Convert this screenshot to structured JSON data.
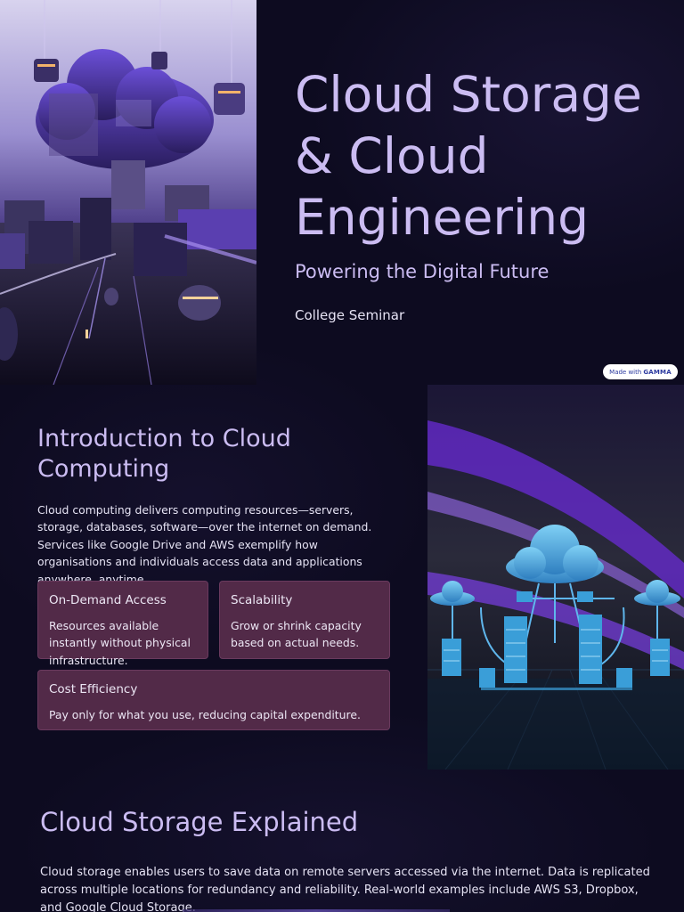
{
  "hero": {
    "title": "Cloud Storage & Cloud Engineering",
    "subtitle": "Powering the Digital Future",
    "tagline": "College Seminar",
    "badge_prefix": "Made with",
    "badge_brand": "GAMMA"
  },
  "intro": {
    "title": "Introduction to Cloud Computing",
    "body": "Cloud computing delivers computing resources—servers, storage, databases, software—over the internet on demand. Services like Google Drive and AWS exemplify how organisations and individuals access data and applications anywhere, anytime.",
    "cards": [
      {
        "title": "On-Demand Access",
        "body": "Resources available instantly without physical infrastructure."
      },
      {
        "title": "Scalability",
        "body": "Grow or shrink capacity based on actual needs."
      },
      {
        "title": "Cost Efficiency",
        "body": "Pay only for what you use, reducing capital expenditure."
      }
    ]
  },
  "storage": {
    "title": "Cloud Storage Explained",
    "body": "Cloud storage enables users to save data on remote servers accessed via the internet. Data is replicated across multiple locations for redundancy and reliability. Real-world examples include AWS S3, Dropbox, and Google Cloud Storage."
  },
  "colors": {
    "background": "#0d0b20",
    "heading": "#cbbcf2",
    "card": "#522a48",
    "accent": "#7b4ff0"
  }
}
